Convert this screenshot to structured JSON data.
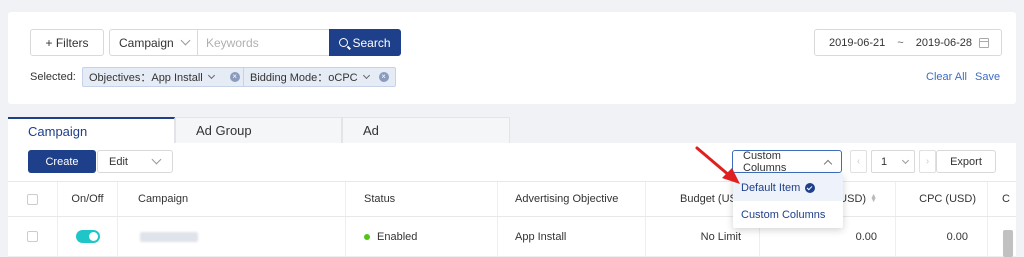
{
  "filters": {
    "filters_label": "+ Filters",
    "campaign_select": "Campaign",
    "keywords_placeholder": "Keywords",
    "search_label": "Search",
    "date_start": "2019-06-21",
    "date_sep": "~",
    "date_end": "2019-06-28",
    "selected_label": "Selected:",
    "tags": [
      {
        "label": "Objectives：App Install"
      },
      {
        "label": "Bidding Mode：oCPC"
      }
    ],
    "clear_all": "Clear All",
    "save": "Save"
  },
  "tabs": [
    {
      "label": "Campaign",
      "active": true
    },
    {
      "label": "Ad Group",
      "active": false
    },
    {
      "label": "Ad",
      "active": false
    }
  ],
  "toolbar": {
    "create": "Create",
    "edit": "Edit",
    "custom_columns": "Custom Columns",
    "page": "1",
    "export": "Export"
  },
  "columns": {
    "onoff": "On/Off",
    "campaign": "Campaign",
    "status": "Status",
    "objective": "Advertising Objective",
    "budget": "Budget (USD)",
    "cost": "(USD)",
    "cpc": "CPC (USD)",
    "more": "C"
  },
  "rows": [
    {
      "on": true,
      "status": "Enabled",
      "objective": "App Install",
      "budget": "No Limit",
      "cost": "0.00",
      "cpc": "0.00"
    }
  ],
  "dropdown": {
    "items": [
      {
        "label": "Default Item",
        "selected": true
      },
      {
        "label": "Custom Columns",
        "selected": false
      }
    ]
  },
  "colors": {
    "primary": "#1e3f8a",
    "link": "#3f6cbf",
    "toggle_on": "#20c6c7",
    "status_enabled": "#52c41a",
    "annotation_arrow": "#e02020"
  }
}
